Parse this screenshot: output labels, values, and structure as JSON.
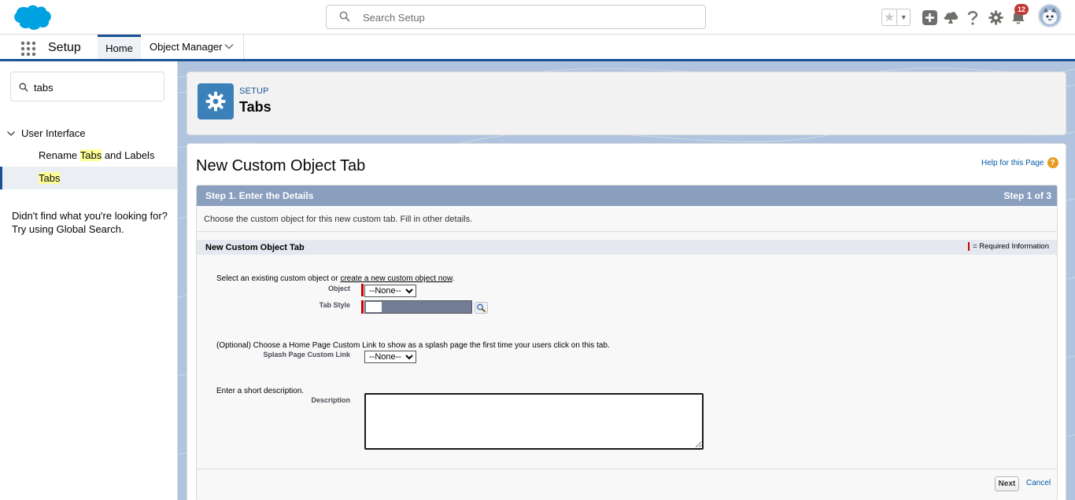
{
  "header": {
    "search_placeholder": "Search Setup",
    "notification_count": "12",
    "icons": [
      "salesforce-cloud-logo",
      "search-icon",
      "star-icon",
      "chevron-down-icon",
      "add-icon",
      "trailhead-icon",
      "help-icon",
      "gear-icon",
      "bell-icon",
      "avatar"
    ]
  },
  "nav": {
    "app_name": "Setup",
    "tabs": [
      {
        "label": "Home"
      },
      {
        "label": "Object Manager"
      }
    ]
  },
  "sidebar": {
    "quickfind_value": "tabs",
    "tree": {
      "label": "User Interface",
      "children": [
        {
          "pre": "Rename ",
          "highlight": "Tabs",
          "post": " and Labels"
        },
        {
          "pre": "",
          "highlight": "Tabs",
          "post": ""
        }
      ]
    },
    "help_line1": "Didn't find what you're looking for?",
    "help_line2": "Try using Global Search."
  },
  "page_header": {
    "eyebrow": "SETUP",
    "title": "Tabs"
  },
  "content": {
    "title": "New Custom Object Tab",
    "help_link": "Help for this Page",
    "step_title": "Step 1. Enter the Details",
    "step_count": "Step 1 of 3",
    "step_description": "Choose the custom object for this new custom tab. Fill in other details.",
    "section_title": "New Custom Object Tab",
    "required_info": "= Required Information",
    "instr_object_pre": "Select an existing custom object or ",
    "instr_object_link": "create a new custom object now",
    "instr_object_post": ".",
    "label_object": "Object",
    "object_selected": "--None--",
    "label_tab_style": "Tab Style",
    "instr_splash": "(Optional) Choose a Home Page Custom Link to show as a splash page the first time your users click on this tab.",
    "label_splash": "Splash Page Custom Link",
    "splash_selected": "--None--",
    "instr_description": "Enter a short description.",
    "label_description": "Description",
    "description_value": "",
    "next_button": "Next",
    "cancel_link": "Cancel"
  },
  "colors": {
    "brand_blue": "#1b5297",
    "step_bar": "#8a9ebe",
    "setup_icon_bg": "#3b80b8",
    "badge_red": "#c23934",
    "required_red": "#cc0000",
    "highlight_yellow": "#ffff99"
  }
}
